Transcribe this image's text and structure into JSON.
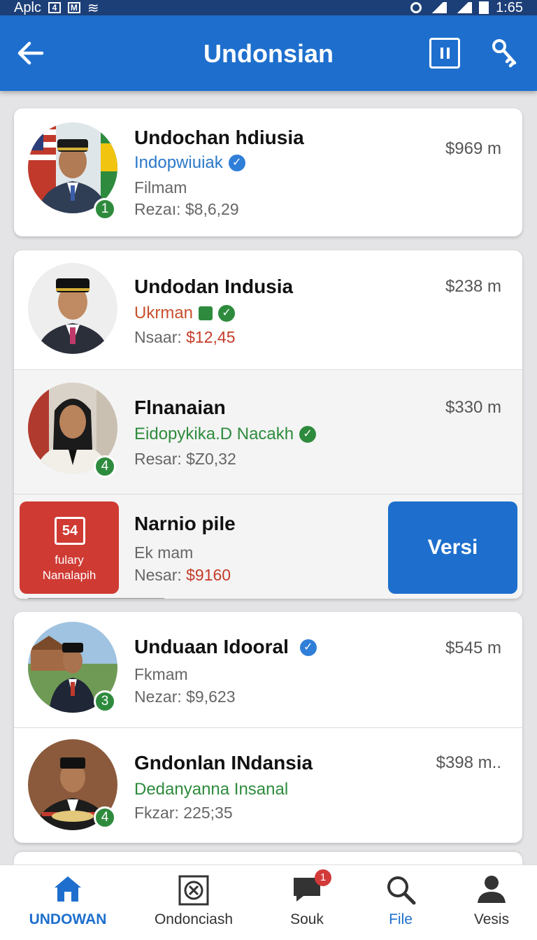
{
  "status_bar": {
    "left_text": "Aplc",
    "box1": "4",
    "box2": "M",
    "time": "1:65"
  },
  "app_bar": {
    "title": "Undonsian"
  },
  "cards": [
    {
      "rows": [
        {
          "name": "Undochan hdiusia",
          "sub": "Indopwiuiak",
          "meta": "Filmam",
          "price_label": "Rezaı:",
          "price_value": "$8,6,29",
          "amount": "$969 m",
          "badge": "1"
        }
      ]
    },
    {
      "rows": [
        {
          "name": "Undodan Indusia",
          "sub": "Ukrman",
          "meta": "",
          "price_label": "Nsaar:",
          "price_value": "$12,45",
          "amount": "$238 m",
          "badge": ""
        },
        {
          "name": "Flnanaian",
          "sub": "Eidopykika.D  Nacakh",
          "meta": "",
          "price_label": "Resar:",
          "price_value": "$Z0,32",
          "amount": "$330 m",
          "badge": "4"
        },
        {
          "name": "Narnio pile",
          "sub": "",
          "meta": "Ek mam",
          "price_label": "Nesar:",
          "price_value": "$9160",
          "amount": "",
          "badge": ""
        }
      ],
      "swipe": {
        "tile_number": "54",
        "tile_line1": "fulary",
        "tile_line2": "Nanalapih",
        "action_label": "Versi"
      }
    },
    {
      "rows": [
        {
          "name": "Unduaan Idooral",
          "sub": "",
          "meta": "Fkmam",
          "price_label": "Nezar:",
          "price_value": "$9,623",
          "amount": "$545 m",
          "badge": "3"
        },
        {
          "name": "Gndonlan INdansia",
          "sub": "Dedanyanna Insanal",
          "meta": "",
          "price_label": "Fkzar:",
          "price_value": "225;35",
          "amount": "$398 m..",
          "badge": "4"
        }
      ]
    }
  ],
  "bottom_nav": [
    {
      "label": "UNDOWAN",
      "icon": "home-icon"
    },
    {
      "label": "Ondonciash",
      "icon": "close-box-icon"
    },
    {
      "label": "Souk",
      "icon": "chat-icon",
      "notification": "1"
    },
    {
      "label": "File",
      "icon": "search-icon"
    },
    {
      "label": "Vesis",
      "icon": "person-icon"
    }
  ],
  "colors": {
    "primary": "#1e6fcd",
    "status_bar": "#1d3f78",
    "green": "#2e8b3d",
    "red": "#cf3a33"
  }
}
